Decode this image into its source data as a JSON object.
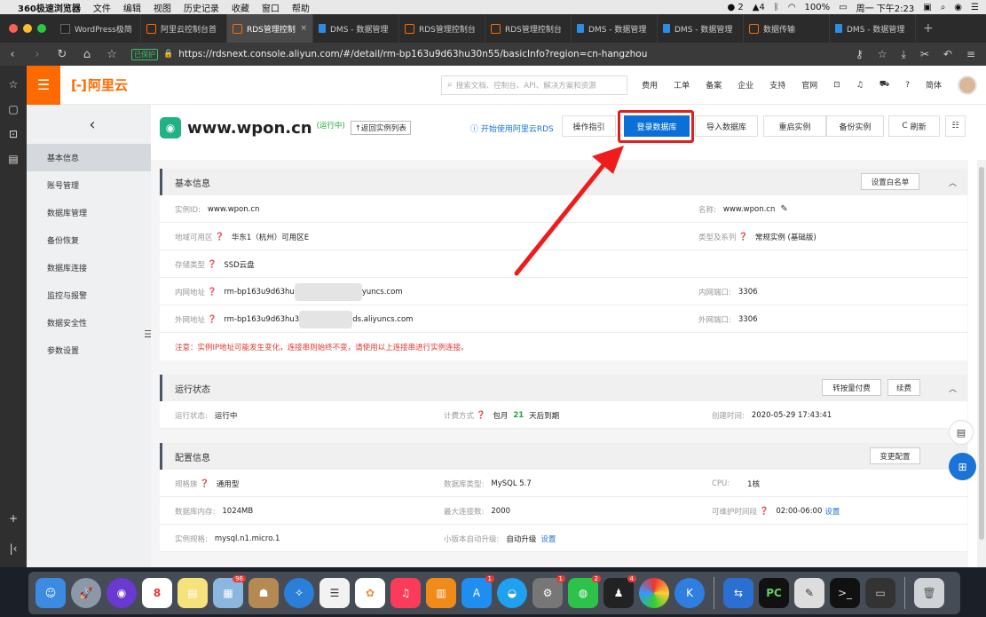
{
  "menubar": {
    "app_name": "360极速浏览器",
    "menus": [
      "文件",
      "编辑",
      "视图",
      "历史记录",
      "收藏",
      "窗口",
      "帮助"
    ],
    "wechat_count": "2",
    "bell_count": "4",
    "battery": "100%",
    "clock": "周一 下午2:23"
  },
  "tabs": [
    {
      "label": "WordPress极简",
      "icon": "wp"
    },
    {
      "label": "阿里云控制台首",
      "icon": "ali"
    },
    {
      "label": "RDS管理控制",
      "icon": "ali",
      "active": true
    },
    {
      "label": "DMS - 数据管理",
      "icon": "dms"
    },
    {
      "label": "RDS管理控制台",
      "icon": "ali"
    },
    {
      "label": "RDS管理控制台",
      "icon": "ali"
    },
    {
      "label": "DMS - 数据管理",
      "icon": "dms"
    },
    {
      "label": "DMS - 数据管理",
      "icon": "dms"
    },
    {
      "label": "数据传输",
      "icon": "ali"
    },
    {
      "label": "DMS - 数据管理",
      "icon": "dms"
    }
  ],
  "addressbar": {
    "secure_badge": "已保护",
    "url": "https://rdsnext.console.aliyun.com/#/detail/rm-bp163u9d63hu30n55/basicInfo?region=cn-hangzhou"
  },
  "topbar": {
    "logo_text": "阿里云",
    "search_placeholder": "搜索文档、控制台、API、解决方案和资源",
    "nav": [
      "费用",
      "工单",
      "备案",
      "企业",
      "支持",
      "官网"
    ],
    "language": "简体"
  },
  "sidebar": {
    "items": [
      "基本信息",
      "账号管理",
      "数据库管理",
      "备份恢复",
      "数据库连接",
      "监控与报警",
      "数据安全性",
      "参数设置"
    ],
    "active_index": 0
  },
  "header": {
    "title": "www.wpon.cn",
    "status": "(运行中)",
    "back_to_list": "↑返回实例列表",
    "help_link": "开始使用阿里云RDS",
    "buttons": {
      "guide": "操作指引",
      "login_db": "登录数据库",
      "import_db": "导入数据库",
      "restart": "重启实例",
      "backup": "备份实例",
      "refresh": "刷新"
    }
  },
  "basic_info": {
    "title": "基本信息",
    "whitelist_btn": "设置白名单",
    "instance_id_label": "实例ID:",
    "instance_id": "www.wpon.cn",
    "name_label": "名称:",
    "name": "www.wpon.cn",
    "zone_label": "地域可用区",
    "zone": "华东1（杭州）可用区E",
    "type_label": "类型及系列",
    "type": "常规实例 (基础版)",
    "storage_label": "存储类型",
    "storage": "SSD云盘",
    "intranet_label": "内网地址",
    "intranet_prefix": "rm-bp163u9d63hu",
    "intranet_suffix": "yuncs.com",
    "intranet_port_label": "内网端口:",
    "intranet_port": "3306",
    "extranet_label": "外网地址",
    "extranet_prefix": "rm-bp163u9d63hu3",
    "extranet_suffix": "ds.aliyuncs.com",
    "extranet_port_label": "外网端口:",
    "extranet_port": "3306",
    "warning": "注意：实例IP地址可能发生变化，连接串则始终不变，请使用以上连接串进行实例连接。"
  },
  "run_status": {
    "title": "运行状态",
    "btn_pay": "转按量付费",
    "btn_renew": "续费",
    "status_label": "运行状态:",
    "status": "运行中",
    "billing_label": "计费方式",
    "billing_prefix": "包月",
    "billing_days": "21",
    "billing_suffix": "天后到期",
    "created_label": "创建时间:",
    "created": "2020-05-29 17:43:41"
  },
  "config": {
    "title": "配置信息",
    "change_btn": "变更配置",
    "family_label": "规格族",
    "family": "通用型",
    "dbtype_label": "数据库类型:",
    "dbtype": "MySQL 5.7",
    "cpu_label": "CPU:",
    "cpu": "1核",
    "mem_label": "数据库内存:",
    "mem": "1024MB",
    "maxconn_label": "最大连接数:",
    "maxconn": "2000",
    "maint_label": "可维护时间段",
    "maint": "02:00-06:00",
    "maint_link": "设置",
    "spec_label": "实例规格:",
    "spec": "mysql.n1.micro.1",
    "upgrade_label": "小版本自动升级:",
    "upgrade": "自动升级",
    "upgrade_link": "设置"
  },
  "dock": {
    "calendar_day": "8",
    "badges": {
      "app4": "96",
      "appstore": "1",
      "prefs": "1",
      "wechat": "2",
      "qq": "4"
    }
  },
  "colors": {
    "accent": "#ff6a00",
    "primary": "#0a6fd6",
    "highlight": "#e01e1e",
    "status_green": "#1da837"
  }
}
